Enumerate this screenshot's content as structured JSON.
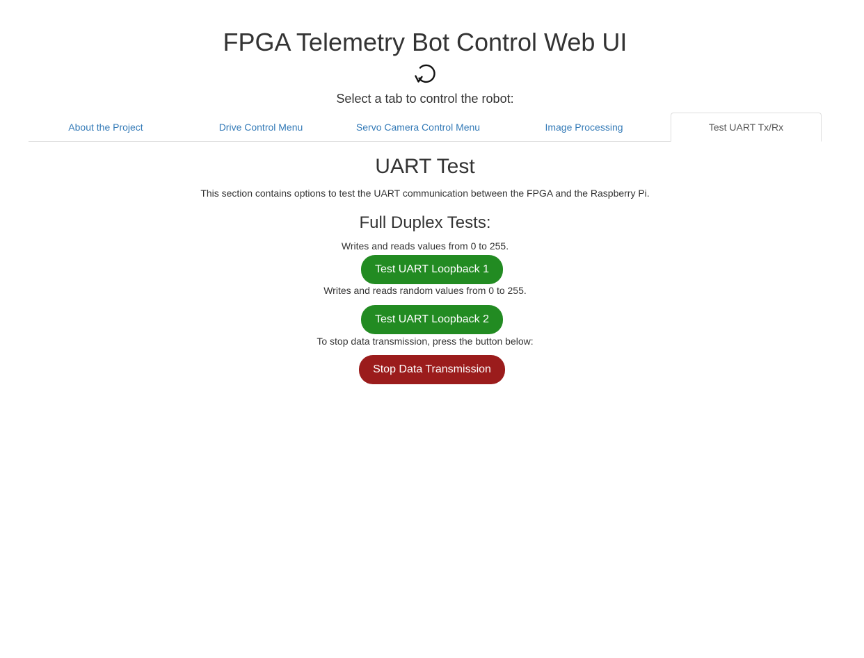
{
  "header": {
    "title": "FPGA Telemetry Bot Control Web UI",
    "subtitle": "Select a tab to control the robot:"
  },
  "tabs": [
    {
      "label": "About the Project",
      "active": false
    },
    {
      "label": "Drive Control Menu",
      "active": false
    },
    {
      "label": "Servo Camera Control Menu",
      "active": false
    },
    {
      "label": "Image Processing",
      "active": false
    },
    {
      "label": "Test UART Tx/Rx",
      "active": true
    }
  ],
  "uart": {
    "title": "UART Test",
    "description": "This section contains options to test the UART communication between the FPGA and the Raspberry Pi.",
    "full_duplex_title": "Full Duplex Tests:",
    "loopback1_note": "Writes and reads values from 0 to 255.",
    "loopback1_button": "Test UART Loopback 1",
    "loopback2_note": "Writes and reads random values from 0 to 255.",
    "loopback2_button": "Test UART Loopback 2",
    "stop_note": "To stop data transmission, press the button below:",
    "stop_button": "Stop Data Transmission"
  },
  "icons": {
    "refresh": "refresh-icon"
  },
  "colors": {
    "tab_link": "#337ab7",
    "button_green": "#228b22",
    "button_red": "#9b1c1c"
  }
}
